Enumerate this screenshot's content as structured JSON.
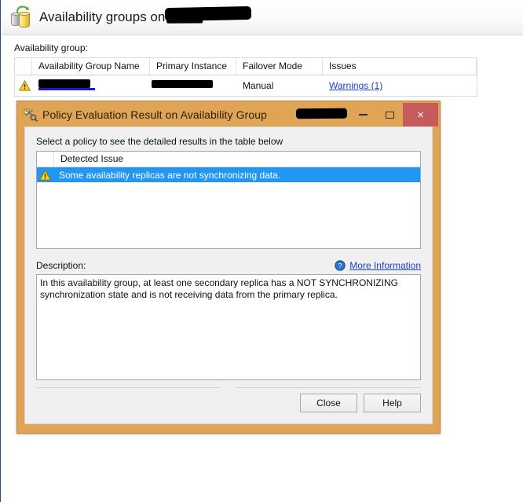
{
  "host": {
    "title": "Availability groups on",
    "title_redacted": true,
    "icon": "database-refresh-icon",
    "group_label": "Availability group:",
    "grid": {
      "columns": [
        "",
        "Availability Group Name",
        "Primary Instance",
        "Failover Mode",
        "Issues"
      ],
      "rows": [
        {
          "status_icon": "warning-triangle-icon",
          "name": "",
          "name_redacted": true,
          "primary_instance": "",
          "primary_instance_redacted": true,
          "failover_mode": "Manual",
          "issues_link": "Warnings (1)"
        }
      ]
    }
  },
  "dialog": {
    "icon": "policy-icon",
    "title": "Policy Evaluation Result on Availability Group",
    "title_redacted": true,
    "window_buttons": {
      "minimize": "minimize-icon",
      "maximize": "maximize-icon",
      "close": "×"
    },
    "instruction": "Select a policy to see the detailed results in the table below",
    "issues": {
      "column_header": "Detected Issue",
      "rows": [
        {
          "icon": "warning-triangle-icon",
          "text": "Some availability replicas are not synchronizing data.",
          "selected": true
        }
      ]
    },
    "description": {
      "label": "Description:",
      "more_information_label": "More Information",
      "help_icon": "help-circle-icon",
      "text": "In this availability group, at least one secondary replica has a NOT SYNCHRONIZING synchronization state and is not receiving data from the primary replica."
    },
    "buttons": {
      "close": "Close",
      "help": "Help"
    }
  },
  "colors": {
    "dialog_border": "#dfa455",
    "selection_blue": "#2196f3",
    "link_blue": "#1a3fd0",
    "close_button_red": "#c75a5a",
    "warning_yellow": "#ffcc00"
  }
}
